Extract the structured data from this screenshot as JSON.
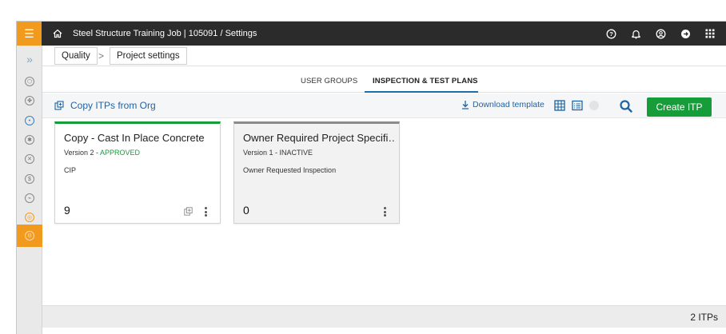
{
  "topbar": {
    "title": "Steel Structure Training Job | 105091  /  Settings",
    "accent": "#f29a1e",
    "icons": [
      "menu-icon",
      "home-icon",
      "help-icon",
      "bell-icon",
      "user-circle-icon",
      "signout-icon",
      "apps-grid-icon"
    ]
  },
  "rail": {
    "expand_glyph": "»",
    "icons": [
      "module-1-icon",
      "module-2-icon",
      "module-3-icon",
      "module-4-icon",
      "module-5-icon",
      "module-6-icon",
      "module-7-icon",
      "module-8-icon",
      "settings-module-icon"
    ]
  },
  "breadcrumb": {
    "items": [
      "Quality",
      "Project settings"
    ],
    "separator": ">"
  },
  "tabs": [
    {
      "label": "USER GROUPS",
      "selected": false
    },
    {
      "label": "INSPECTION & TEST PLANS",
      "selected": true
    }
  ],
  "toolbar": {
    "copy_label": "Copy ITPs from Org",
    "download_label": "Download template",
    "create_label": "Create ITP",
    "create_color": "#179c3a",
    "link_color": "#1f63a5"
  },
  "cards": [
    {
      "title": "Copy - Cast In Place Concrete",
      "version": "Version 2 - ",
      "status": "APPROVED",
      "subtitle": "CIP",
      "count": "9",
      "status_color": "#179c3a"
    },
    {
      "title": "Owner Required Project Specifi…",
      "version": "Version 1 - ",
      "status": "INACTIVE",
      "subtitle": "Owner Requested Inspection",
      "count": "0",
      "status_color": "#333333"
    }
  ],
  "footer": {
    "count_label": "2 ITPs"
  }
}
